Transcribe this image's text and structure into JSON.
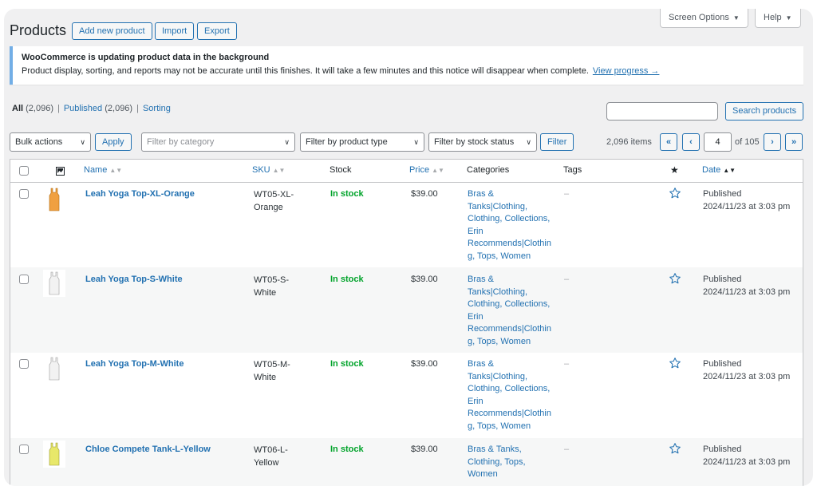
{
  "header": {
    "title": "Products",
    "add_new": "Add new product",
    "import": "Import",
    "export": "Export",
    "screen_options": "Screen Options",
    "help": "Help"
  },
  "notice": {
    "title": "WooCommerce is updating product data in the background",
    "body": "Product display, sorting, and reports may not be accurate until this finishes. It will take a few minutes and this notice will disappear when complete.",
    "link": "View progress →"
  },
  "views": {
    "all": "All",
    "all_count": "(2,096)",
    "published": "Published",
    "published_count": "(2,096)",
    "sorting": "Sorting",
    "sep": "|"
  },
  "search": {
    "value": "",
    "button": "Search products"
  },
  "filters": {
    "bulk_actions": "Bulk actions",
    "apply": "Apply",
    "category": "Filter by category",
    "product_type": "Filter by product type",
    "stock_status": "Filter by stock status",
    "filter": "Filter"
  },
  "pagination": {
    "items": "2,096 items",
    "first": "«",
    "prev": "‹",
    "current": "4",
    "of": "of 105",
    "next": "›",
    "last": "»"
  },
  "columns": {
    "name": "Name",
    "sku": "SKU",
    "stock": "Stock",
    "price": "Price",
    "categories": "Categories",
    "tags": "Tags",
    "date": "Date"
  },
  "icons": {
    "image_col": "image-icon",
    "featured_col": "star-filled-icon",
    "featured_row": "star-outline-icon",
    "sort": "sort-arrows-icon"
  },
  "colors": {
    "accent": "#2271b1",
    "in_stock": "#00a32a",
    "notice_border": "#72aee6"
  },
  "rows": [
    {
      "name": "Leah Yoga Top-XL-Orange",
      "sku_line1": "WT05-XL-",
      "sku_line2": "Orange",
      "stock": "In stock",
      "price": "$39.00",
      "cat1": "Bras &",
      "cat2": "Tanks|Clothing,",
      "cat3": "Clothing, Collections,",
      "cat4": "Erin",
      "cat5": "Recommends|Clothin",
      "cat6": "g, Tops, Women",
      "tags": "–",
      "status": "Published",
      "date": "2024/11/23 at 3:03 pm",
      "color": "#f0a040"
    },
    {
      "name": "Leah Yoga Top-S-White",
      "sku_line1": "WT05-S-White",
      "sku_line2": "",
      "stock": "In stock",
      "price": "$39.00",
      "cat1": "Bras &",
      "cat2": "Tanks|Clothing,",
      "cat3": "Clothing, Collections,",
      "cat4": "Erin",
      "cat5": "Recommends|Clothin",
      "cat6": "g, Tops, Women",
      "tags": "–",
      "status": "Published",
      "date": "2024/11/23 at 3:03 pm",
      "color": "#eeeeee"
    },
    {
      "name": "Leah Yoga Top-M-White",
      "sku_line1": "WT05-M-White",
      "sku_line2": "",
      "stock": "In stock",
      "price": "$39.00",
      "cat1": "Bras &",
      "cat2": "Tanks|Clothing,",
      "cat3": "Clothing, Collections,",
      "cat4": "Erin",
      "cat5": "Recommends|Clothin",
      "cat6": "g, Tops, Women",
      "tags": "–",
      "status": "Published",
      "date": "2024/11/23 at 3:03 pm",
      "color": "#eeeeee"
    },
    {
      "name": "Chloe Compete Tank-L-Yellow",
      "sku_line1": "WT06-L-Yellow",
      "sku_line2": "",
      "stock": "In stock",
      "price": "$39.00",
      "cat1": "Bras & Tanks,",
      "cat2": "Clothing, Tops,",
      "cat3": "Women",
      "cat4": "",
      "cat5": "",
      "cat6": "",
      "tags": "–",
      "status": "Published",
      "date": "2024/11/23 at 3:03 pm",
      "color": "#e8e86a"
    }
  ]
}
